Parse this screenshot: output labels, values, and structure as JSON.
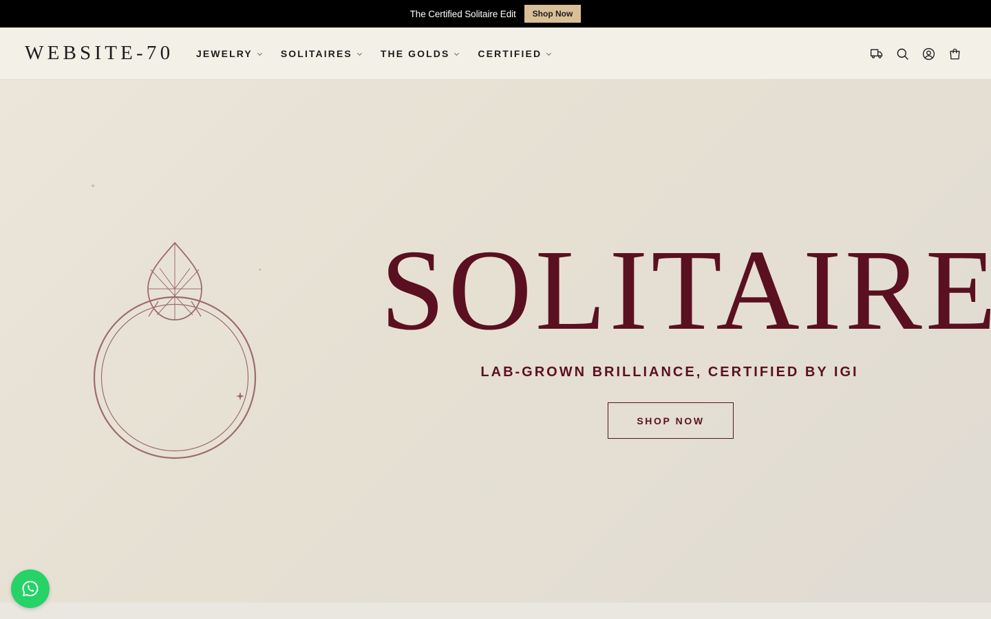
{
  "announcement": {
    "text": "The Certified Solitaire Edit",
    "button_label": "Shop Now",
    "button_color": "#d9bf98"
  },
  "header": {
    "logo": "WEBSITE-70",
    "nav": [
      {
        "label": "JEWELRY",
        "icon": "chevron-down-icon"
      },
      {
        "label": "SOLITAIRES",
        "icon": "chevron-down-icon"
      },
      {
        "label": "THE GOLDS",
        "icon": "chevron-down-icon"
      },
      {
        "label": "CERTIFIED",
        "icon": "chevron-down-icon"
      }
    ],
    "icons": [
      "truck-icon",
      "search-icon",
      "account-icon",
      "cart-icon"
    ]
  },
  "hero": {
    "title": "SOLITAIRE",
    "subtitle": "LAB-GROWN BRILLIANCE, CERTIFIED BY IGI",
    "button_label": "SHOP NOW",
    "illustration": "pear-diamond-ring-icon",
    "accent_color": "#5a1020"
  },
  "floating": {
    "icon": "whatsapp-icon",
    "color": "#25d366"
  }
}
